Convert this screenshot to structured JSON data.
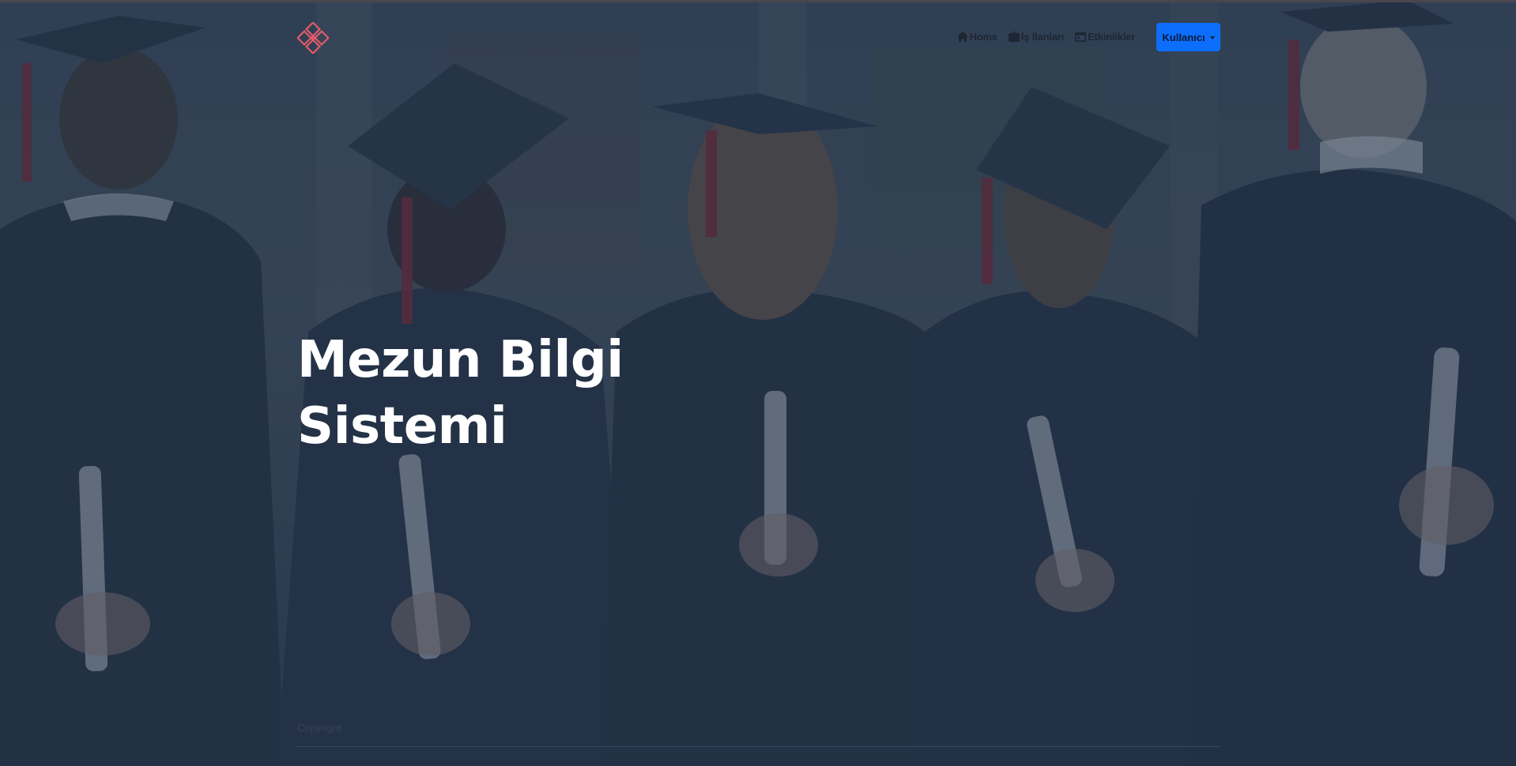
{
  "brand": {
    "logo_icon": "clover-diamond-logo-icon",
    "logo_color": "#e05a6a"
  },
  "nav": {
    "items": [
      {
        "label": "Home",
        "icon": "home-icon"
      },
      {
        "label": "İş İlanları",
        "icon": "briefcase-icon"
      },
      {
        "label": "Etkinlikler",
        "icon": "calendar-icon"
      }
    ],
    "user_button_label": "Kullanıcı"
  },
  "hero": {
    "title_line1": "Mezun Bilgi",
    "title_line2": "Sistemi",
    "bottom_label": "Copyright"
  },
  "colors": {
    "accent": "#0d6efd",
    "overlay": "#26364e",
    "title": "#ffffff"
  }
}
